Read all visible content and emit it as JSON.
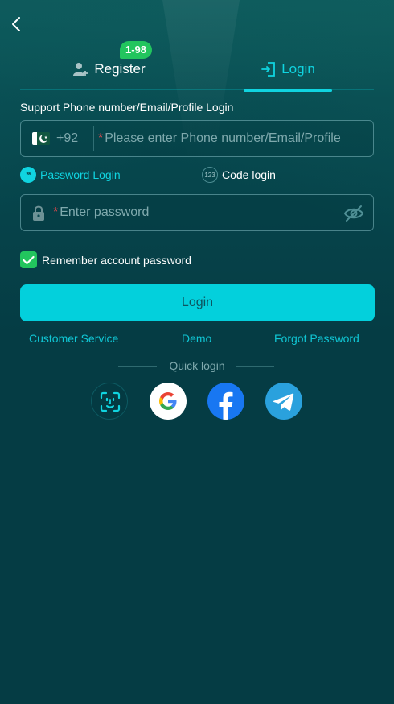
{
  "header": {
    "back_icon": "chevron-left-icon"
  },
  "tabs": {
    "register_label": "Register",
    "register_icon": "add-user-icon",
    "register_badge": "1-98",
    "login_label": "Login",
    "login_icon": "login-door-icon",
    "active": "login"
  },
  "form": {
    "support_label": "Support Phone number/Email/Profile Login",
    "country_flag": "pakistan-flag-icon",
    "country_code": "+92",
    "phone_required_mark": "*",
    "phone_placeholder": "Please enter Phone number/Email/Profile",
    "modes": {
      "password_label": "Password Login",
      "password_icon_text": "**",
      "code_label": "Code login",
      "code_icon_text": "123",
      "active": "password"
    },
    "password_required_mark": "*",
    "password_placeholder": "Enter password",
    "lock_icon": "lock-icon",
    "eye_icon": "eye-off-icon",
    "remember_label": "Remember account password",
    "remember_checked": true,
    "login_button": "Login"
  },
  "links": {
    "customer_service": "Customer Service",
    "demo": "Demo",
    "forgot_password": "Forgot Password"
  },
  "quick_login": {
    "label": "Quick login",
    "providers": [
      "face-id-icon",
      "google-icon",
      "facebook-icon",
      "telegram-icon"
    ]
  },
  "colors": {
    "background": "#053c44",
    "accent": "#03d0dc",
    "badge": "#22c55e",
    "checkbox": "#22c55e",
    "required": "#e5484d"
  }
}
